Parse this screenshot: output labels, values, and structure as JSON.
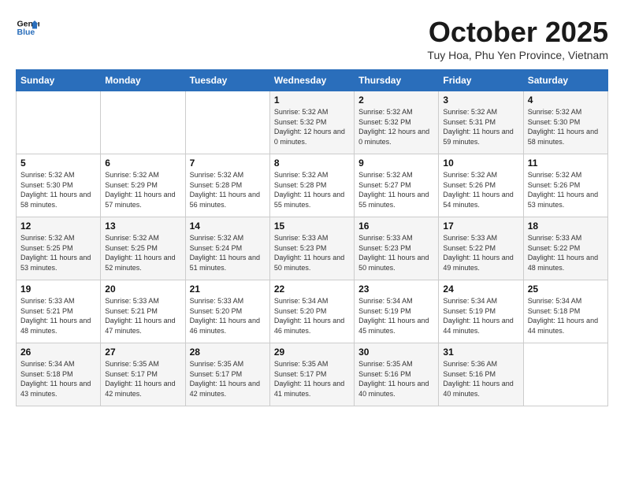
{
  "logo": {
    "line1": "General",
    "line2": "Blue"
  },
  "title": "October 2025",
  "location": "Tuy Hoa, Phu Yen Province, Vietnam",
  "headers": [
    "Sunday",
    "Monday",
    "Tuesday",
    "Wednesday",
    "Thursday",
    "Friday",
    "Saturday"
  ],
  "weeks": [
    [
      {
        "day": "",
        "sunrise": "",
        "sunset": "",
        "daylight": ""
      },
      {
        "day": "",
        "sunrise": "",
        "sunset": "",
        "daylight": ""
      },
      {
        "day": "",
        "sunrise": "",
        "sunset": "",
        "daylight": ""
      },
      {
        "day": "1",
        "sunrise": "Sunrise: 5:32 AM",
        "sunset": "Sunset: 5:32 PM",
        "daylight": "Daylight: 12 hours and 0 minutes."
      },
      {
        "day": "2",
        "sunrise": "Sunrise: 5:32 AM",
        "sunset": "Sunset: 5:32 PM",
        "daylight": "Daylight: 12 hours and 0 minutes."
      },
      {
        "day": "3",
        "sunrise": "Sunrise: 5:32 AM",
        "sunset": "Sunset: 5:31 PM",
        "daylight": "Daylight: 11 hours and 59 minutes."
      },
      {
        "day": "4",
        "sunrise": "Sunrise: 5:32 AM",
        "sunset": "Sunset: 5:30 PM",
        "daylight": "Daylight: 11 hours and 58 minutes."
      }
    ],
    [
      {
        "day": "5",
        "sunrise": "Sunrise: 5:32 AM",
        "sunset": "Sunset: 5:30 PM",
        "daylight": "Daylight: 11 hours and 58 minutes."
      },
      {
        "day": "6",
        "sunrise": "Sunrise: 5:32 AM",
        "sunset": "Sunset: 5:29 PM",
        "daylight": "Daylight: 11 hours and 57 minutes."
      },
      {
        "day": "7",
        "sunrise": "Sunrise: 5:32 AM",
        "sunset": "Sunset: 5:28 PM",
        "daylight": "Daylight: 11 hours and 56 minutes."
      },
      {
        "day": "8",
        "sunrise": "Sunrise: 5:32 AM",
        "sunset": "Sunset: 5:28 PM",
        "daylight": "Daylight: 11 hours and 55 minutes."
      },
      {
        "day": "9",
        "sunrise": "Sunrise: 5:32 AM",
        "sunset": "Sunset: 5:27 PM",
        "daylight": "Daylight: 11 hours and 55 minutes."
      },
      {
        "day": "10",
        "sunrise": "Sunrise: 5:32 AM",
        "sunset": "Sunset: 5:26 PM",
        "daylight": "Daylight: 11 hours and 54 minutes."
      },
      {
        "day": "11",
        "sunrise": "Sunrise: 5:32 AM",
        "sunset": "Sunset: 5:26 PM",
        "daylight": "Daylight: 11 hours and 53 minutes."
      }
    ],
    [
      {
        "day": "12",
        "sunrise": "Sunrise: 5:32 AM",
        "sunset": "Sunset: 5:25 PM",
        "daylight": "Daylight: 11 hours and 53 minutes."
      },
      {
        "day": "13",
        "sunrise": "Sunrise: 5:32 AM",
        "sunset": "Sunset: 5:25 PM",
        "daylight": "Daylight: 11 hours and 52 minutes."
      },
      {
        "day": "14",
        "sunrise": "Sunrise: 5:32 AM",
        "sunset": "Sunset: 5:24 PM",
        "daylight": "Daylight: 11 hours and 51 minutes."
      },
      {
        "day": "15",
        "sunrise": "Sunrise: 5:33 AM",
        "sunset": "Sunset: 5:23 PM",
        "daylight": "Daylight: 11 hours and 50 minutes."
      },
      {
        "day": "16",
        "sunrise": "Sunrise: 5:33 AM",
        "sunset": "Sunset: 5:23 PM",
        "daylight": "Daylight: 11 hours and 50 minutes."
      },
      {
        "day": "17",
        "sunrise": "Sunrise: 5:33 AM",
        "sunset": "Sunset: 5:22 PM",
        "daylight": "Daylight: 11 hours and 49 minutes."
      },
      {
        "day": "18",
        "sunrise": "Sunrise: 5:33 AM",
        "sunset": "Sunset: 5:22 PM",
        "daylight": "Daylight: 11 hours and 48 minutes."
      }
    ],
    [
      {
        "day": "19",
        "sunrise": "Sunrise: 5:33 AM",
        "sunset": "Sunset: 5:21 PM",
        "daylight": "Daylight: 11 hours and 48 minutes."
      },
      {
        "day": "20",
        "sunrise": "Sunrise: 5:33 AM",
        "sunset": "Sunset: 5:21 PM",
        "daylight": "Daylight: 11 hours and 47 minutes."
      },
      {
        "day": "21",
        "sunrise": "Sunrise: 5:33 AM",
        "sunset": "Sunset: 5:20 PM",
        "daylight": "Daylight: 11 hours and 46 minutes."
      },
      {
        "day": "22",
        "sunrise": "Sunrise: 5:34 AM",
        "sunset": "Sunset: 5:20 PM",
        "daylight": "Daylight: 11 hours and 46 minutes."
      },
      {
        "day": "23",
        "sunrise": "Sunrise: 5:34 AM",
        "sunset": "Sunset: 5:19 PM",
        "daylight": "Daylight: 11 hours and 45 minutes."
      },
      {
        "day": "24",
        "sunrise": "Sunrise: 5:34 AM",
        "sunset": "Sunset: 5:19 PM",
        "daylight": "Daylight: 11 hours and 44 minutes."
      },
      {
        "day": "25",
        "sunrise": "Sunrise: 5:34 AM",
        "sunset": "Sunset: 5:18 PM",
        "daylight": "Daylight: 11 hours and 44 minutes."
      }
    ],
    [
      {
        "day": "26",
        "sunrise": "Sunrise: 5:34 AM",
        "sunset": "Sunset: 5:18 PM",
        "daylight": "Daylight: 11 hours and 43 minutes."
      },
      {
        "day": "27",
        "sunrise": "Sunrise: 5:35 AM",
        "sunset": "Sunset: 5:17 PM",
        "daylight": "Daylight: 11 hours and 42 minutes."
      },
      {
        "day": "28",
        "sunrise": "Sunrise: 5:35 AM",
        "sunset": "Sunset: 5:17 PM",
        "daylight": "Daylight: 11 hours and 42 minutes."
      },
      {
        "day": "29",
        "sunrise": "Sunrise: 5:35 AM",
        "sunset": "Sunset: 5:17 PM",
        "daylight": "Daylight: 11 hours and 41 minutes."
      },
      {
        "day": "30",
        "sunrise": "Sunrise: 5:35 AM",
        "sunset": "Sunset: 5:16 PM",
        "daylight": "Daylight: 11 hours and 40 minutes."
      },
      {
        "day": "31",
        "sunrise": "Sunrise: 5:36 AM",
        "sunset": "Sunset: 5:16 PM",
        "daylight": "Daylight: 11 hours and 40 minutes."
      },
      {
        "day": "",
        "sunrise": "",
        "sunset": "",
        "daylight": ""
      }
    ]
  ]
}
